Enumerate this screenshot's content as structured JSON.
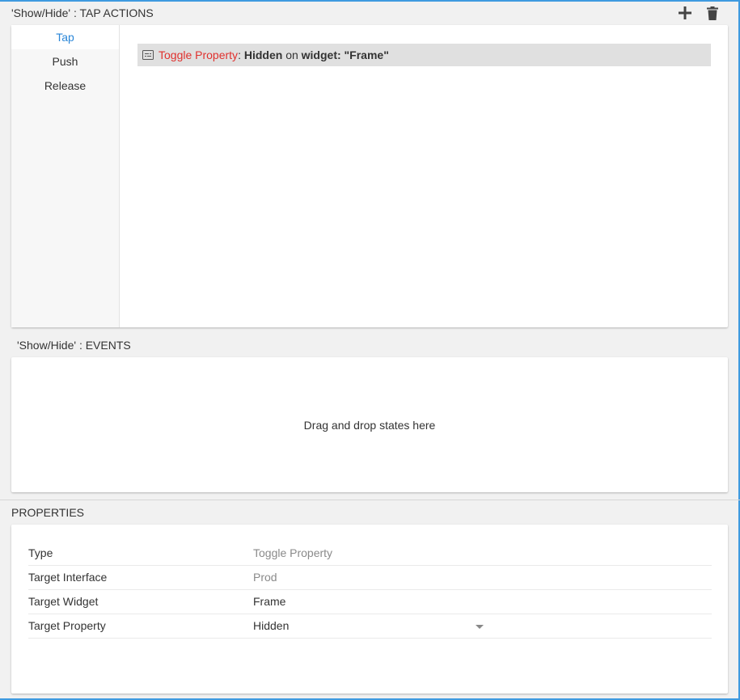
{
  "tap_actions": {
    "title": "'Show/Hide' : TAP ACTIONS",
    "icons": {
      "add": "plus-icon",
      "delete": "trash-icon"
    },
    "tabs": [
      {
        "label": "Tap",
        "active": true
      },
      {
        "label": "Push",
        "active": false
      },
      {
        "label": "Release",
        "active": false
      }
    ],
    "action": {
      "icon": "toggle-property-icon",
      "type": "Toggle Property",
      "colon": ":",
      "property": "Hidden",
      "on_text": "on",
      "widget_prefix": "widget:",
      "widget_name": "\"Frame\""
    }
  },
  "events": {
    "title": "'Show/Hide' : EVENTS",
    "placeholder": "Drag and drop states here"
  },
  "properties": {
    "title": "PROPERTIES",
    "rows": [
      {
        "label": "Type",
        "value": "Toggle Property"
      },
      {
        "label": "Target Interface",
        "value": "Prod"
      },
      {
        "label": "Target Widget",
        "value": "Frame"
      },
      {
        "label": "Target Property",
        "value": "Hidden"
      }
    ]
  },
  "colors": {
    "accent": "#2b87d8",
    "action_type": "#e0312e",
    "border": "#3f9ae0"
  }
}
